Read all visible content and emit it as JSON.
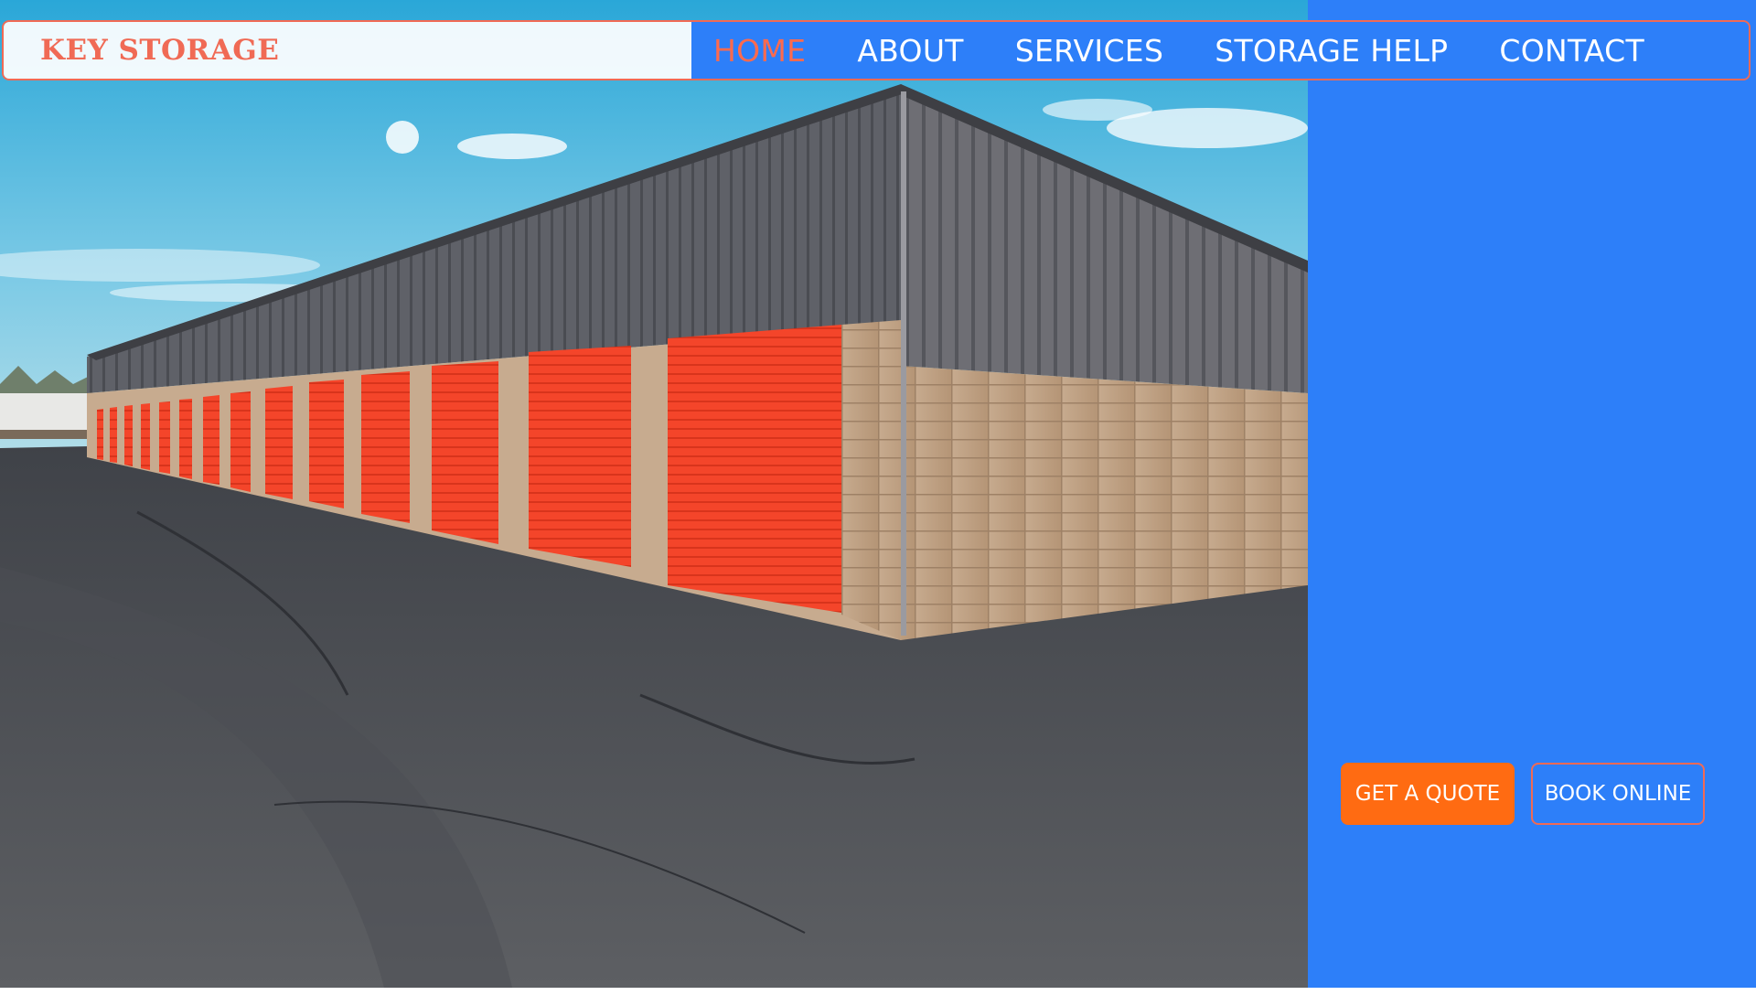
{
  "brand": {
    "name": "KEY STORAGE",
    "color": "#f06a55"
  },
  "nav": {
    "items": [
      {
        "label": "HOME",
        "active": true
      },
      {
        "label": "ABOUT",
        "active": false
      },
      {
        "label": "SERVICES",
        "active": false
      },
      {
        "label": "STORAGE HELP",
        "active": false
      },
      {
        "label": "CONTACT",
        "active": false
      }
    ]
  },
  "cta": {
    "quote_label": "GET A QUOTE",
    "book_label": "BOOK ONLINE"
  },
  "colors": {
    "panel_blue": "#2d7ff9",
    "accent_orange": "#ff6b12",
    "active_nav": "#ff6a4d",
    "door_orange": "#f4452a"
  }
}
